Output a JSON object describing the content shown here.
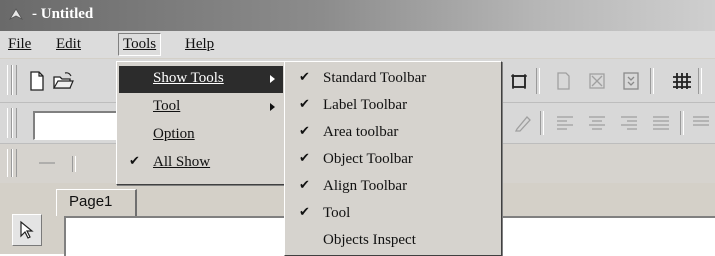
{
  "window": {
    "title": "- Untitled"
  },
  "menubar": [
    {
      "name": "menu-file",
      "label": "File"
    },
    {
      "name": "menu-edit",
      "label": "Edit"
    },
    {
      "name": "menu-tools",
      "label": "Tools"
    },
    {
      "name": "menu-help",
      "label": "Help"
    }
  ],
  "tools_menu": [
    {
      "label": "Show Tools",
      "checked": false,
      "submenu": true,
      "highlighted": true
    },
    {
      "label": "Tool",
      "checked": false,
      "submenu": true,
      "highlighted": false
    },
    {
      "label": "Option",
      "checked": false,
      "submenu": false,
      "highlighted": false
    },
    {
      "label": "All Show",
      "checked": true,
      "submenu": false,
      "highlighted": false
    }
  ],
  "show_tools_submenu": [
    {
      "label": "Standard Toolbar",
      "checked": true
    },
    {
      "label": "Label Toolbar",
      "checked": true
    },
    {
      "label": "Area toolbar",
      "checked": true
    },
    {
      "label": "Object Toolbar",
      "checked": true
    },
    {
      "label": "Align Toolbar",
      "checked": true
    },
    {
      "label": "Tool",
      "checked": true
    },
    {
      "label": "Objects Inspect",
      "checked": false
    }
  ],
  "tabs": {
    "page1": "Page1"
  },
  "icons": {
    "check": "✔",
    "toolbar_icons": [
      "new-document-icon",
      "open-folder-icon",
      "frame-icon",
      "page-icon",
      "delete-icon",
      "sort-icon",
      "grid-icon",
      "pencil-icon",
      "align-left-icon",
      "align-center-icon",
      "align-right-icon",
      "justify-icon",
      "line-icon",
      "pointer-icon"
    ]
  }
}
